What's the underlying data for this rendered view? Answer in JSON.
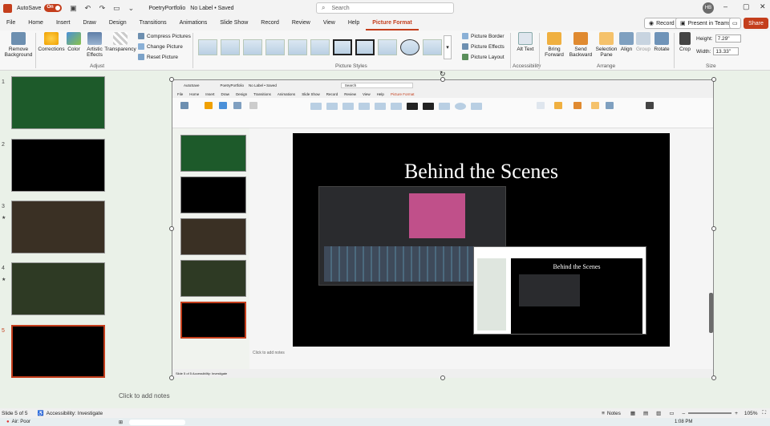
{
  "titlebar": {
    "autosave": "AutoSave",
    "toggle": "On",
    "doc_title": "PoetryPortfolio",
    "label_info": "No Label • Saved",
    "search_placeholder": "Search",
    "avatar": "HB"
  },
  "menu": [
    "File",
    "Home",
    "Insert",
    "Draw",
    "Design",
    "Transitions",
    "Animations",
    "Slide Show",
    "Record",
    "Review",
    "View",
    "Help",
    "Picture Format"
  ],
  "active_menu": "Picture Format",
  "top_buttons": {
    "record": "Record",
    "present": "Present in Teams",
    "share": "Share"
  },
  "ribbon": {
    "remove_bg": "Remove Background",
    "corrections": "Corrections",
    "color": "Color",
    "artistic": "Artistic Effects",
    "transparency": "Transparency",
    "compress": "Compress Pictures",
    "change": "Change Picture",
    "reset": "Reset Picture",
    "adjust_label": "Adjust",
    "picture_styles_label": "Picture Styles",
    "border": "Picture Border",
    "effects": "Picture Effects",
    "layout": "Picture Layout",
    "alt_text": "Alt Text",
    "accessibility_label": "Accessibility",
    "bring_forward": "Bring Forward",
    "send_backward": "Send Backward",
    "selection_pane": "Selection Pane",
    "align": "Align",
    "group": "Group",
    "rotate": "Rotate",
    "arrange_label": "Arrange",
    "crop": "Crop",
    "height_label": "Height:",
    "height_value": "7.29\"",
    "width_label": "Width:",
    "width_value": "13.33\"",
    "size_label": "Size"
  },
  "slides": [
    {
      "num": "1",
      "star": false
    },
    {
      "num": "2",
      "star": false
    },
    {
      "num": "3",
      "star": true
    },
    {
      "num": "4",
      "star": true
    },
    {
      "num": "5",
      "star": false
    }
  ],
  "active_slide": "5",
  "nested": {
    "autosave": "AutoSave",
    "doc": "PoetryPortfolio",
    "label": "No Label • Saved",
    "search": "Search",
    "menu": [
      "File",
      "Home",
      "Insert",
      "Draw",
      "Design",
      "Transitions",
      "Animations",
      "Slide Show",
      "Record",
      "Review",
      "View",
      "Help",
      "Picture Format"
    ],
    "slide_title": "Behind the Scenes",
    "notes": "Click to add notes",
    "status": "Slide 5 of 5   Accessibility: Investigate"
  },
  "main_slide_title": "Behind the Scenes",
  "notes_placeholder": "Click to add notes",
  "status": {
    "slide": "Slide 5 of 5",
    "accessibility": "Accessibility: Investigate",
    "notes": "Notes",
    "zoom": "105%"
  },
  "taskbar": {
    "air": "Air: Poor",
    "time": "1:08 PM"
  },
  "colors": {
    "accent": "#c43e1c"
  }
}
